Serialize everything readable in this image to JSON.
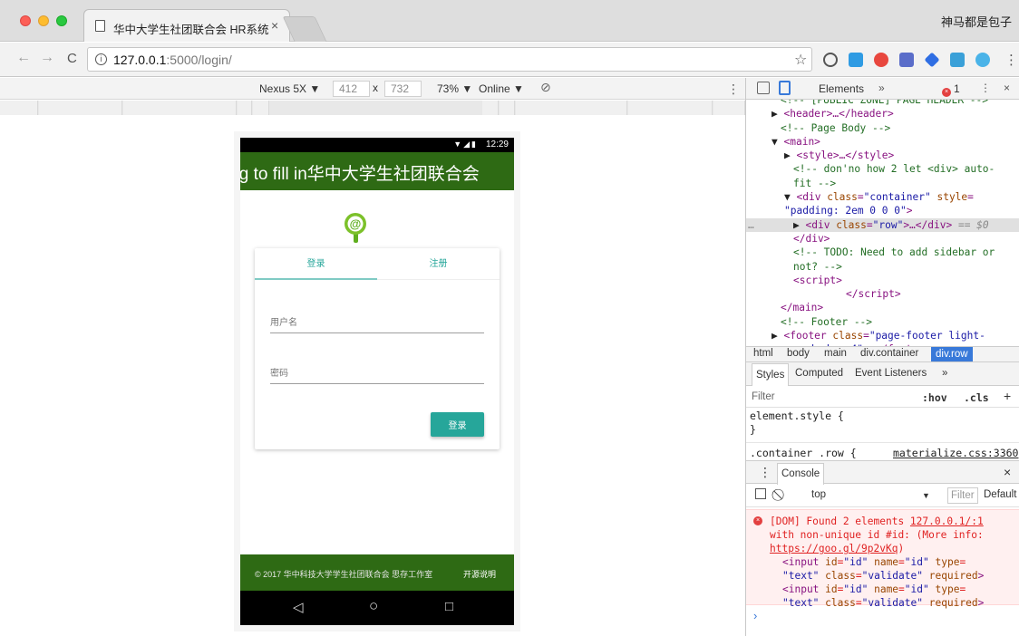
{
  "browser": {
    "tab_title": "华中大学生社团联合会 HR系统",
    "tab_close": "×",
    "user_name": "神马都是包子",
    "url_host": "127.0.0.1",
    "url_rest": ":5000/login/",
    "back": "←",
    "forward": "→",
    "reload": "C",
    "star": "☆",
    "menu": "⋮"
  },
  "device_toolbar": {
    "device": "Nexus 5X ▼",
    "width": "412",
    "times": "x",
    "height": "732",
    "zoom": "73% ▼",
    "network": "Online ▼",
    "menu": "⋮"
  },
  "phone": {
    "status_time": "12:29",
    "status_icons": "▼◢▮",
    "header_marquee": "ing to fill in华中大学生社团联合会",
    "tabs": {
      "login": "登录",
      "register": "注册"
    },
    "username_placeholder": "用户名",
    "password_placeholder": "密码",
    "login_button": "登录",
    "footer_copy": "© 2017 华中科技大学学生社团联合会 思存工作室",
    "footer_about": "开源说明",
    "nav_back": "◁",
    "nav_home": "○",
    "nav_recent": "□"
  },
  "devtools": {
    "panel": "Elements",
    "more": "»",
    "error_count": "1",
    "kebab": "⋮",
    "close": "×",
    "breadcrumbs": [
      "html",
      "body",
      "main",
      "div.container",
      "div.row"
    ],
    "styles_tabs": [
      "Styles",
      "Computed",
      "Event Listeners",
      "»"
    ],
    "filter_label": "Filter",
    "filter_hov": ":hov",
    "filter_cls": ".cls",
    "filter_plus": "+",
    "style_rule1": "element.style {",
    "style_rule1_end": "}",
    "style_rule2": ".container .row {",
    "style_rule2_src": "materialize.css:3360",
    "console_tab": "Console",
    "console_close": "×",
    "console_context": "top",
    "console_context_arrow": "▼",
    "console_filter": "Filter",
    "console_level": "Default",
    "prompt": "›"
  }
}
